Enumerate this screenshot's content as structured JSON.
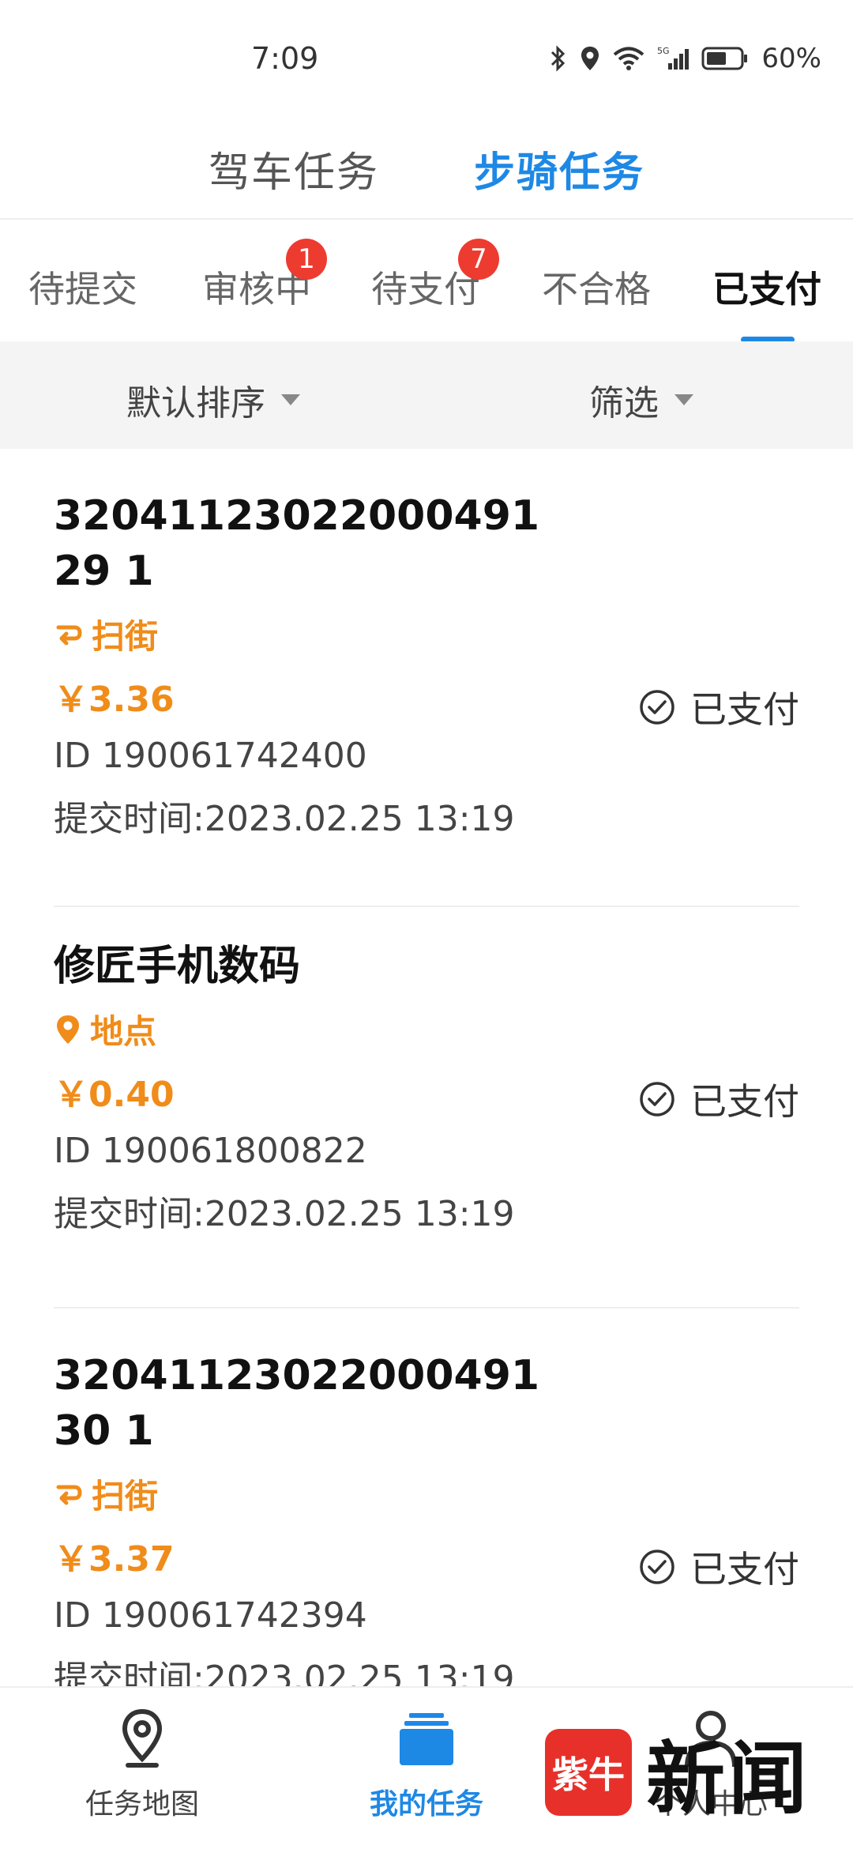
{
  "status_bar": {
    "time": "7:09",
    "battery": "60%"
  },
  "top_tabs": [
    {
      "label": "驾车任务",
      "active": false
    },
    {
      "label": "步骑任务",
      "active": true
    }
  ],
  "status_tabs": [
    {
      "label": "待提交",
      "badge": null
    },
    {
      "label": "审核中",
      "badge": "1"
    },
    {
      "label": "待支付",
      "badge": "7"
    },
    {
      "label": "不合格",
      "badge": null
    },
    {
      "label": "已支付",
      "badge": null,
      "active": true
    }
  ],
  "sort_bar": {
    "sort_label": "默认排序",
    "filter_label": "筛选"
  },
  "tasks": [
    {
      "title": "3204112302200049129 1",
      "type_label": "扫街",
      "type_icon": "route-icon",
      "price": "￥3.36",
      "id": "ID 190061742400",
      "submit_time": "提交时间:2023.02.25 13:19",
      "status": "已支付"
    },
    {
      "title": "修匠手机数码",
      "type_label": "地点",
      "type_icon": "location-pin-icon",
      "price": "￥0.40",
      "id": "ID 190061800822",
      "submit_time": "提交时间:2023.02.25 13:19",
      "status": "已支付"
    },
    {
      "title": "3204112302200049130 1",
      "type_label": "扫街",
      "type_icon": "route-icon",
      "price": "￥3.37",
      "id": "ID 190061742394",
      "submit_time": "提交时间:2023.02.25 13:19",
      "status": "已支付"
    }
  ],
  "bottom_nav": [
    {
      "label": "任务地图",
      "icon": "map-pin-icon"
    },
    {
      "label": "我的任务",
      "icon": "task-stack-icon",
      "active": true
    },
    {
      "label": "个人中心",
      "icon": "person-icon"
    }
  ],
  "watermark": {
    "seal": "紫牛",
    "text": "新闻"
  },
  "colors": {
    "accent": "#1e88e5",
    "orange": "#f08c1a",
    "badge": "#ee3b30"
  }
}
